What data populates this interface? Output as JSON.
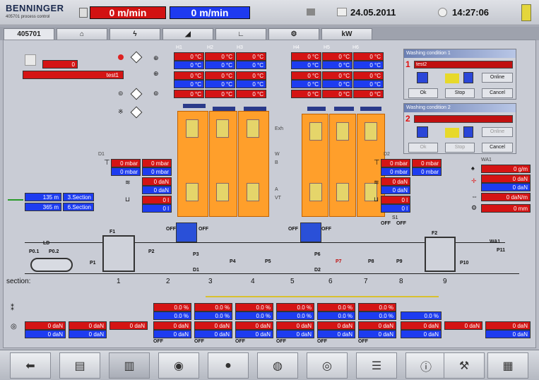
{
  "header": {
    "brand": "BENNINGER",
    "brand_sub": "405701 process control",
    "speed_actual": "0 m/min",
    "speed_set": "0 m/min",
    "date": "24.05.2011",
    "time": "14:27:06",
    "colors": {
      "actual": "#d21212",
      "set": "#1e3af0"
    }
  },
  "tabs": [
    "405701",
    "home-icon",
    "fault-icon",
    "ramp-icon",
    "trend-icon",
    "motor-icon",
    "kw-icon"
  ],
  "tab_kw_label": "kW",
  "left": {
    "counter": "0",
    "recipe": "test1",
    "length_1": "135 m",
    "section_1": "3.Section",
    "length_2": "365 m",
    "section_2": "6.Section"
  },
  "temp_labels": {
    "h1": "H1",
    "h2": "H2",
    "h3": "H3",
    "h4": "H4",
    "h5": "H5",
    "h6": "H6"
  },
  "temps_left": [
    [
      "0 °C",
      "0 °C",
      "0 °C"
    ],
    [
      "0 °C",
      "0 °C",
      "0 °C"
    ],
    [
      "0 °C",
      "0 °C",
      "0 °C"
    ],
    [
      "0 °C",
      "0 °C",
      "0 °C"
    ]
  ],
  "temps_right": [
    [
      "0 °C",
      "0 °C",
      "0 °C"
    ],
    [
      "0 °C",
      "0 °C",
      "0 °C"
    ],
    [
      "0 °C",
      "0 °C",
      "0 °C"
    ],
    [
      "0 °C",
      "0 °C",
      "0 °C"
    ]
  ],
  "d1": {
    "label": "D1",
    "mbar_red": "0 mbar",
    "mbar_blue": "0 mbar",
    "mbar_red2": "0 mbar",
    "mbar_blue2": "0 mbar",
    "dan_red": "0 daN",
    "dan_blue": "0 daN",
    "l_red": "0 l",
    "l_blue": "0 l"
  },
  "d2": {
    "label": "D2",
    "mbar_red": "0 mbar",
    "mbar_blue": "0 mbar",
    "mbar_red2": "0 mbar",
    "mbar_blue2": "0 mbar",
    "dan_red": "0 daN",
    "dan_blue": "0 daN",
    "l_red": "0 l",
    "l_blue": "0 l"
  },
  "wa1": {
    "label": "WA1",
    "gm": "0 g/m",
    "dan_red": "0 daN",
    "dan_blue": "0 daN",
    "danm": "0 daN/m",
    "mm": "0 mm"
  },
  "dialog1": {
    "num": "1",
    "title": "Washing condition 1",
    "select": "test2",
    "online": "Online",
    "ok": "Ok",
    "stop": "Stop",
    "cancel": "Cancel"
  },
  "dialog2": {
    "num": "2",
    "title": "Washing condition 2",
    "select": "",
    "online": "Online",
    "ok": "Ok",
    "stop": "Stop",
    "cancel": "Cancel"
  },
  "tower_labels": {
    "exh": "Exh",
    "w": "W",
    "b": "B",
    "a": "A",
    "vt": "VT"
  },
  "process": {
    "section_label": "section:",
    "sections": [
      "1",
      "2",
      "3",
      "4",
      "5",
      "6",
      "7",
      "8",
      "9"
    ],
    "parts": [
      "LD",
      "P0.1",
      "P0.2",
      "P1",
      "F1",
      "P2",
      "P3",
      "D1",
      "P4",
      "P5",
      "D2",
      "P6",
      "P7",
      "P8",
      "P9",
      "F2",
      "P10",
      "WA1",
      "P11",
      "S1"
    ],
    "off": "OFF"
  },
  "bottom_percent": [
    "0.0 %",
    "0.0 %",
    "0.0 %",
    "0.0 %",
    "0.0 %",
    "0.0 %"
  ],
  "bottom_percent_blue": [
    "0.0 %",
    "0.0 %",
    "0.0 %",
    "0.0 %",
    "0.0 %",
    "0.0 %",
    "0.0 %"
  ],
  "bottom_dan_red": [
    "0 daN",
    "0 daN",
    "0 daN",
    "0 daN",
    "0 daN",
    "0 daN",
    "0 daN",
    "0 daN",
    "0 daN",
    "0 daN",
    "0 daN",
    "0 daN",
    "0 daN"
  ],
  "bottom_dan_blue": [
    "0 daN",
    "0 daN",
    "0 daN",
    "0 daN",
    "0 daN",
    "0 daN",
    "0 daN",
    "0 daN",
    "0 daN",
    "0 daN",
    "0 daN",
    "0 daN"
  ],
  "toolbar": [
    "back-icon",
    "document-icon",
    "machine-icon",
    "dosing-icon",
    "roller-icon",
    "pump-icon",
    "valve-icon",
    "filter-icon",
    "info-icon",
    "service-icon",
    "plant-icon"
  ]
}
